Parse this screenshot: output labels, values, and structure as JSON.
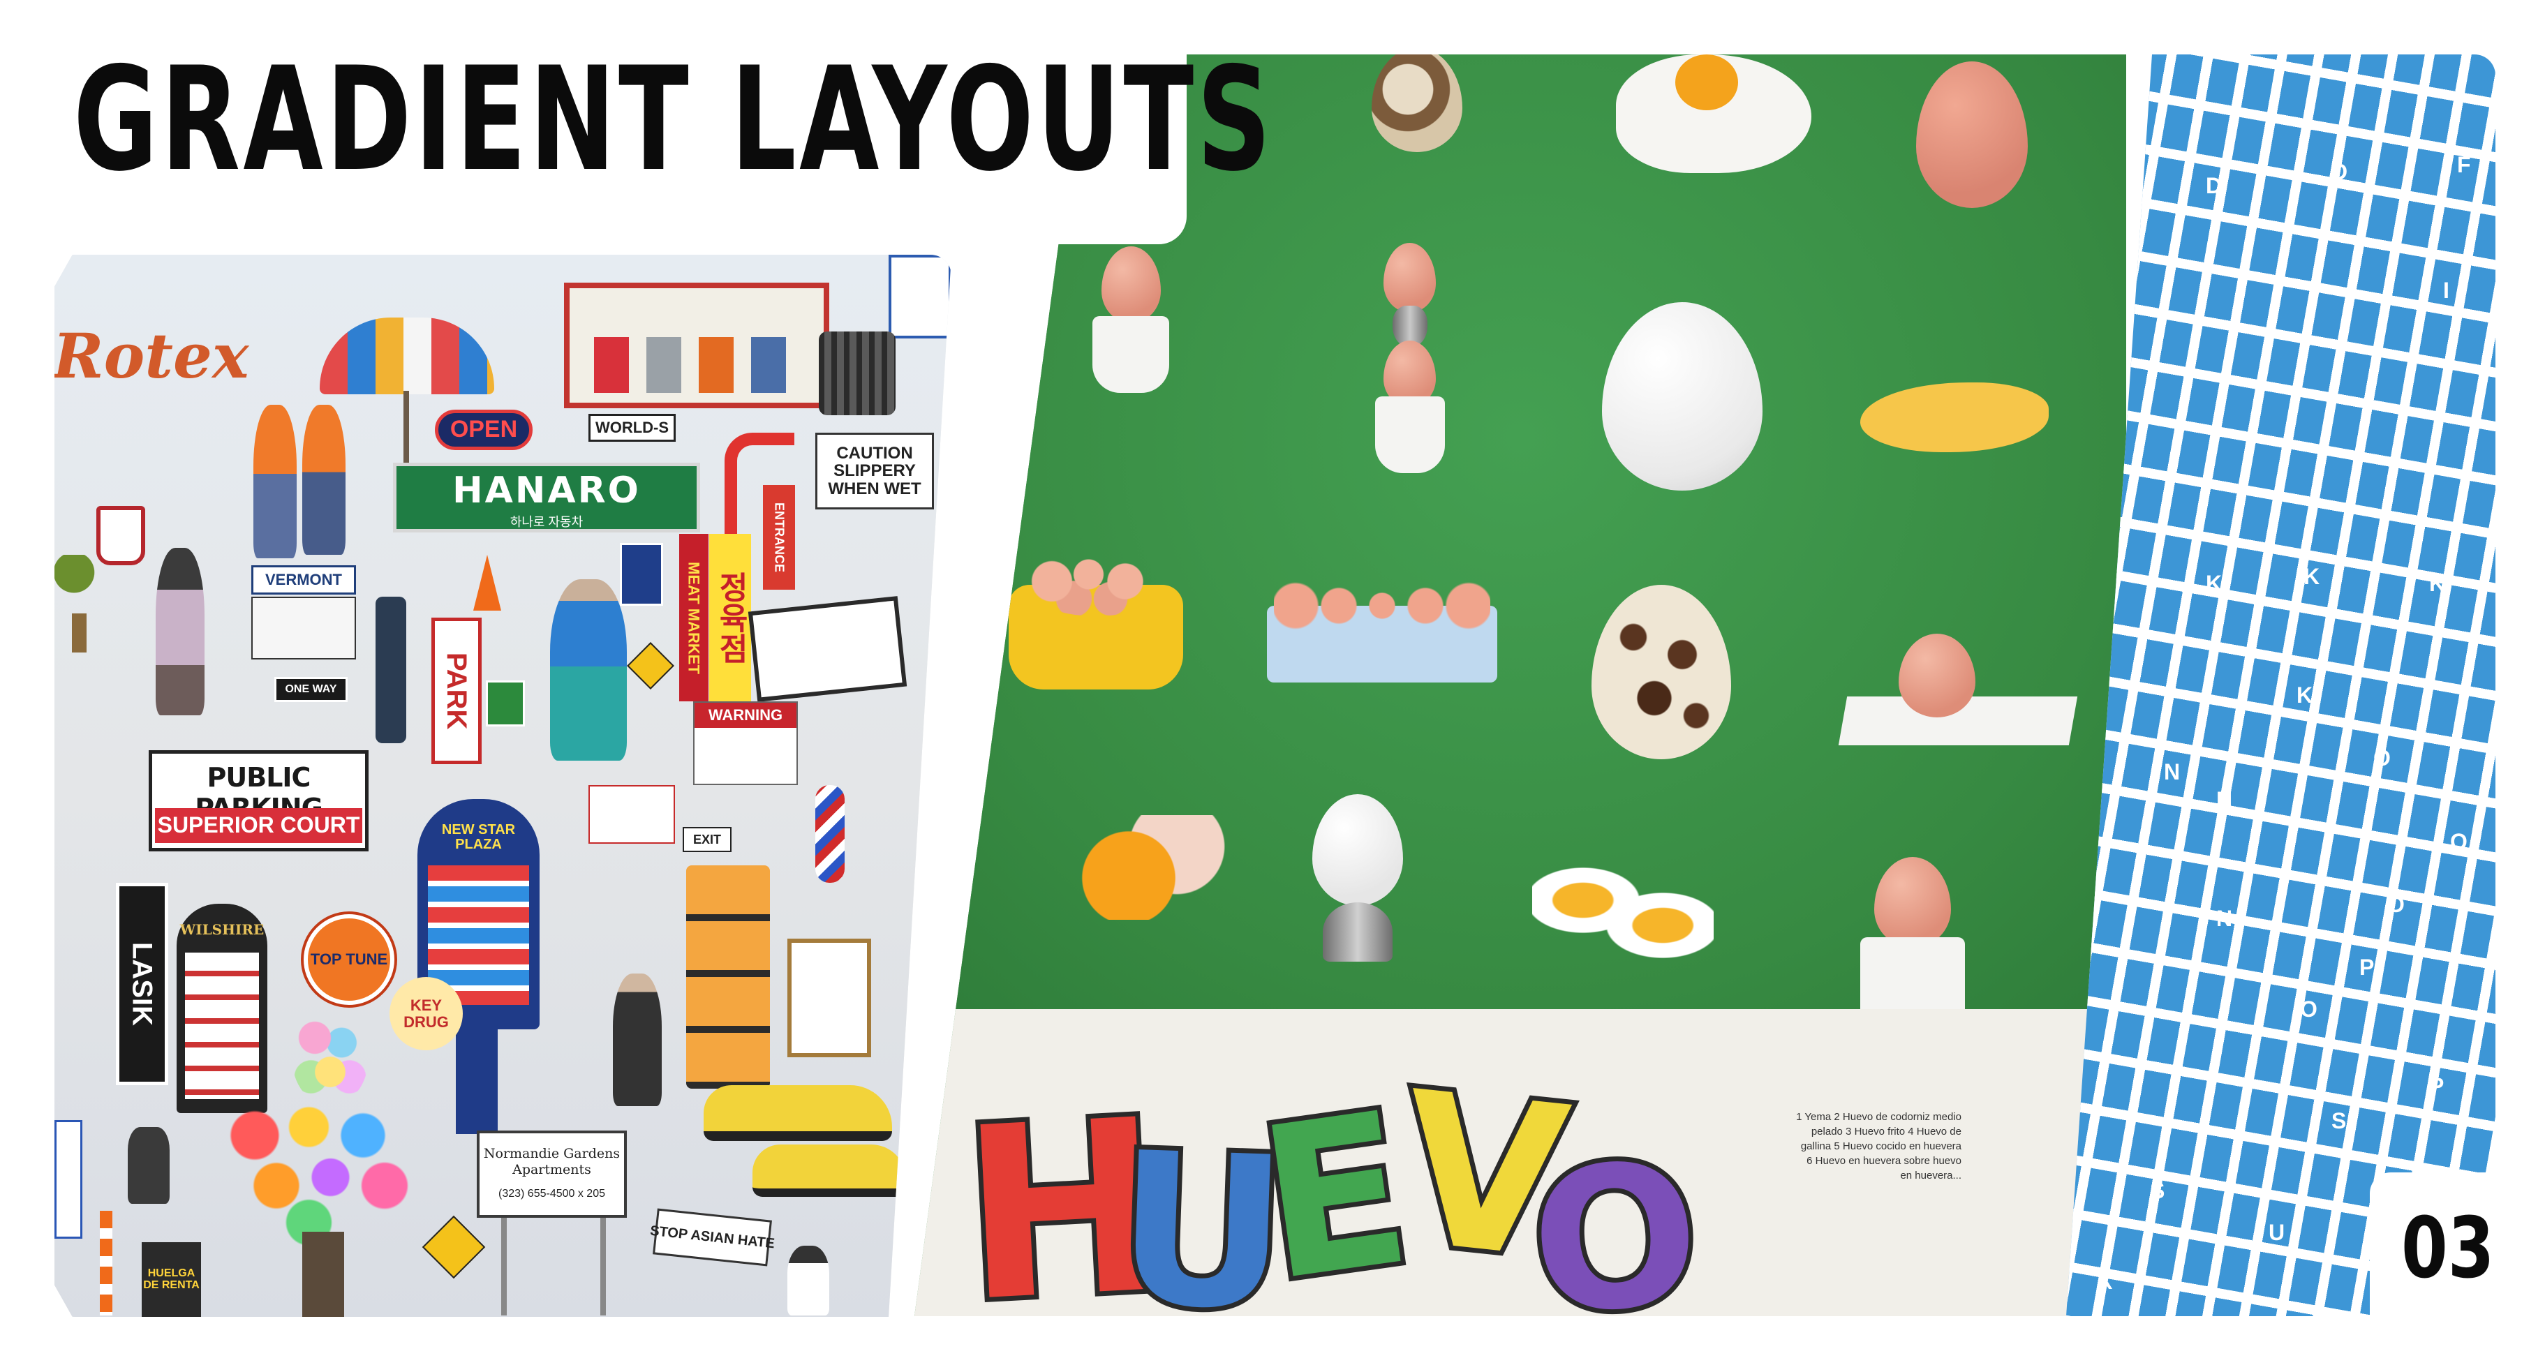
{
  "slide": {
    "title": "GRADIENT LAYOUTS",
    "page_number": "03",
    "colors": {
      "ink": "#0b0b0b",
      "green": "#3a8f45",
      "blue": "#3d96d6",
      "paper": "#f1efe9"
    }
  },
  "collage_signs": {
    "rotex": "Rotex",
    "open": "OPEN",
    "world": "WORLD-S",
    "hanaro": "HANARO",
    "hanaro_sub": "하나로 자동차",
    "caution": "CAUTION\nSLIPPERY\nWHEN WET",
    "vermont": "VERMONT",
    "one_way": "ONE WAY",
    "park": "PARK",
    "meat_market": "MEAT MARKET",
    "korean_meat": "정육점",
    "entrance": "ENTRANCE",
    "warning": "WARNING",
    "public_parking": "PUBLIC PARKING",
    "superior_court": "SUPERIOR COURT",
    "lasik": "LASIK",
    "wilshire": "WILSHIRE",
    "top_tune": "TOP TUNE",
    "key_drug": "KEY DRUG",
    "new_star_plaza": "NEW STAR PLAZA",
    "exit": "EXIT",
    "normandie": "Normandie Gardens\nApartments",
    "normandie_phone": "(323) 655-4500 x 205",
    "stop_asian_hate": "STOP ASIAN HATE",
    "huelga": "HUELGA DE RENTA"
  },
  "poster": {
    "title_letters": [
      "H",
      "U",
      "E",
      "V",
      "O"
    ],
    "legend": "1 Yema 2 Huevo de codorniz medio pelado 3 Huevo frito 4 Huevo de gallina 5 Huevo cocido en huevera 6 Huevo en huevera sobre huevo en huevera..."
  },
  "letter_panel": {
    "letters": [
      "D",
      "D",
      "F",
      "I",
      "K",
      "K",
      "K",
      "K",
      "N",
      "N",
      "N",
      "O",
      "O",
      "O",
      "O",
      "P",
      "P",
      "S",
      "S",
      "U",
      "X"
    ]
  }
}
